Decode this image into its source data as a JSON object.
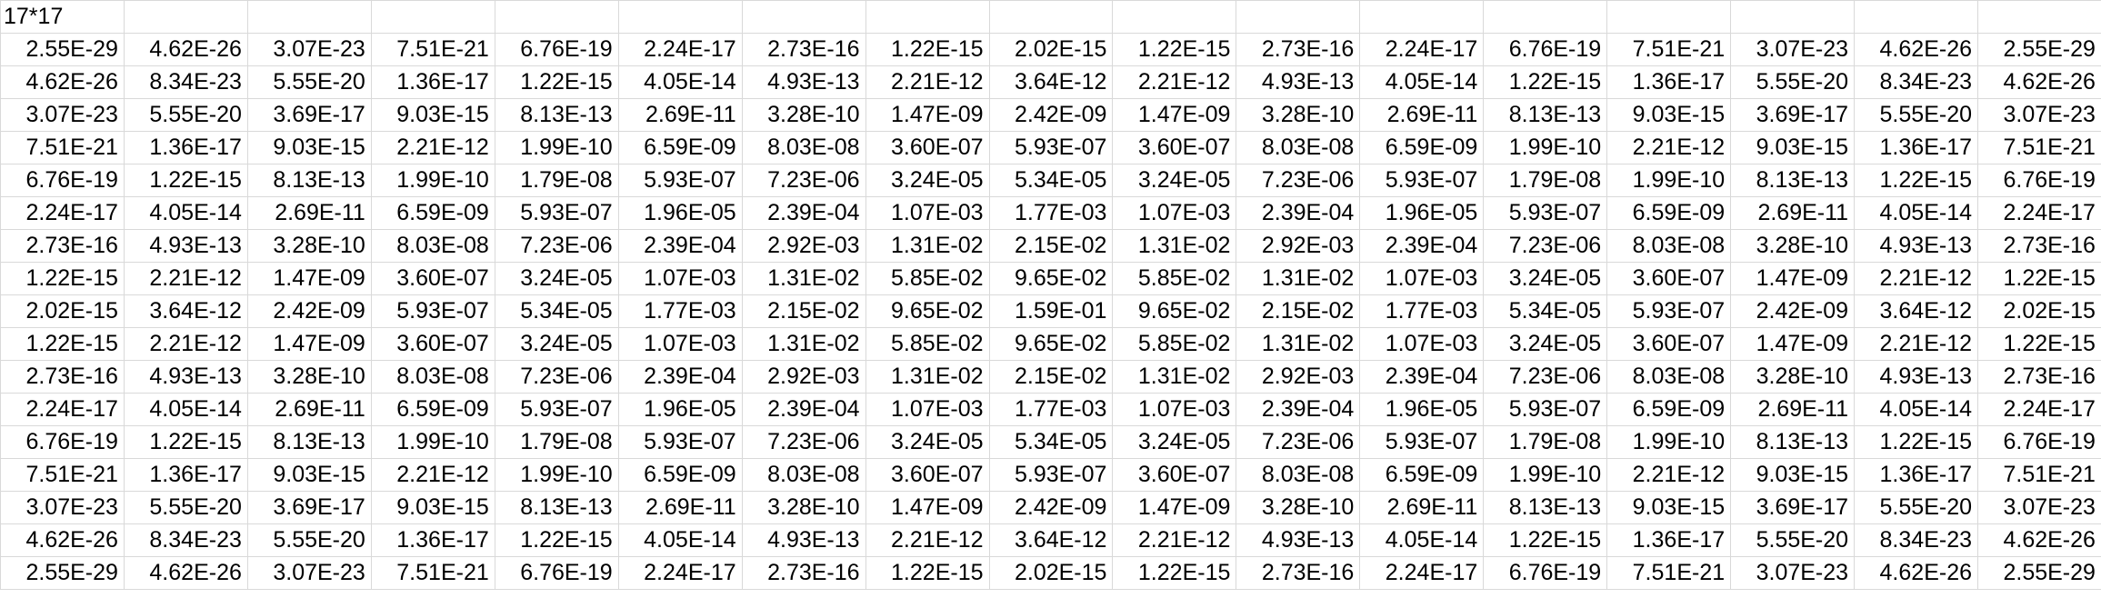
{
  "sheet": {
    "title_cell": "17*17",
    "rows": [
      [
        "2.55E-29",
        "4.62E-26",
        "3.07E-23",
        "7.51E-21",
        "6.76E-19",
        "2.24E-17",
        "2.73E-16",
        "1.22E-15",
        "2.02E-15",
        "1.22E-15",
        "2.73E-16",
        "2.24E-17",
        "6.76E-19",
        "7.51E-21",
        "3.07E-23",
        "4.62E-26",
        "2.55E-29"
      ],
      [
        "4.62E-26",
        "8.34E-23",
        "5.55E-20",
        "1.36E-17",
        "1.22E-15",
        "4.05E-14",
        "4.93E-13",
        "2.21E-12",
        "3.64E-12",
        "2.21E-12",
        "4.93E-13",
        "4.05E-14",
        "1.22E-15",
        "1.36E-17",
        "5.55E-20",
        "8.34E-23",
        "4.62E-26"
      ],
      [
        "3.07E-23",
        "5.55E-20",
        "3.69E-17",
        "9.03E-15",
        "8.13E-13",
        "2.69E-11",
        "3.28E-10",
        "1.47E-09",
        "2.42E-09",
        "1.47E-09",
        "3.28E-10",
        "2.69E-11",
        "8.13E-13",
        "9.03E-15",
        "3.69E-17",
        "5.55E-20",
        "3.07E-23"
      ],
      [
        "7.51E-21",
        "1.36E-17",
        "9.03E-15",
        "2.21E-12",
        "1.99E-10",
        "6.59E-09",
        "8.03E-08",
        "3.60E-07",
        "5.93E-07",
        "3.60E-07",
        "8.03E-08",
        "6.59E-09",
        "1.99E-10",
        "2.21E-12",
        "9.03E-15",
        "1.36E-17",
        "7.51E-21"
      ],
      [
        "6.76E-19",
        "1.22E-15",
        "8.13E-13",
        "1.99E-10",
        "1.79E-08",
        "5.93E-07",
        "7.23E-06",
        "3.24E-05",
        "5.34E-05",
        "3.24E-05",
        "7.23E-06",
        "5.93E-07",
        "1.79E-08",
        "1.99E-10",
        "8.13E-13",
        "1.22E-15",
        "6.76E-19"
      ],
      [
        "2.24E-17",
        "4.05E-14",
        "2.69E-11",
        "6.59E-09",
        "5.93E-07",
        "1.96E-05",
        "2.39E-04",
        "1.07E-03",
        "1.77E-03",
        "1.07E-03",
        "2.39E-04",
        "1.96E-05",
        "5.93E-07",
        "6.59E-09",
        "2.69E-11",
        "4.05E-14",
        "2.24E-17"
      ],
      [
        "2.73E-16",
        "4.93E-13",
        "3.28E-10",
        "8.03E-08",
        "7.23E-06",
        "2.39E-04",
        "2.92E-03",
        "1.31E-02",
        "2.15E-02",
        "1.31E-02",
        "2.92E-03",
        "2.39E-04",
        "7.23E-06",
        "8.03E-08",
        "3.28E-10",
        "4.93E-13",
        "2.73E-16"
      ],
      [
        "1.22E-15",
        "2.21E-12",
        "1.47E-09",
        "3.60E-07",
        "3.24E-05",
        "1.07E-03",
        "1.31E-02",
        "5.85E-02",
        "9.65E-02",
        "5.85E-02",
        "1.31E-02",
        "1.07E-03",
        "3.24E-05",
        "3.60E-07",
        "1.47E-09",
        "2.21E-12",
        "1.22E-15"
      ],
      [
        "2.02E-15",
        "3.64E-12",
        "2.42E-09",
        "5.93E-07",
        "5.34E-05",
        "1.77E-03",
        "2.15E-02",
        "9.65E-02",
        "1.59E-01",
        "9.65E-02",
        "2.15E-02",
        "1.77E-03",
        "5.34E-05",
        "5.93E-07",
        "2.42E-09",
        "3.64E-12",
        "2.02E-15"
      ],
      [
        "1.22E-15",
        "2.21E-12",
        "1.47E-09",
        "3.60E-07",
        "3.24E-05",
        "1.07E-03",
        "1.31E-02",
        "5.85E-02",
        "9.65E-02",
        "5.85E-02",
        "1.31E-02",
        "1.07E-03",
        "3.24E-05",
        "3.60E-07",
        "1.47E-09",
        "2.21E-12",
        "1.22E-15"
      ],
      [
        "2.73E-16",
        "4.93E-13",
        "3.28E-10",
        "8.03E-08",
        "7.23E-06",
        "2.39E-04",
        "2.92E-03",
        "1.31E-02",
        "2.15E-02",
        "1.31E-02",
        "2.92E-03",
        "2.39E-04",
        "7.23E-06",
        "8.03E-08",
        "3.28E-10",
        "4.93E-13",
        "2.73E-16"
      ],
      [
        "2.24E-17",
        "4.05E-14",
        "2.69E-11",
        "6.59E-09",
        "5.93E-07",
        "1.96E-05",
        "2.39E-04",
        "1.07E-03",
        "1.77E-03",
        "1.07E-03",
        "2.39E-04",
        "1.96E-05",
        "5.93E-07",
        "6.59E-09",
        "2.69E-11",
        "4.05E-14",
        "2.24E-17"
      ],
      [
        "6.76E-19",
        "1.22E-15",
        "8.13E-13",
        "1.99E-10",
        "1.79E-08",
        "5.93E-07",
        "7.23E-06",
        "3.24E-05",
        "5.34E-05",
        "3.24E-05",
        "7.23E-06",
        "5.93E-07",
        "1.79E-08",
        "1.99E-10",
        "8.13E-13",
        "1.22E-15",
        "6.76E-19"
      ],
      [
        "7.51E-21",
        "1.36E-17",
        "9.03E-15",
        "2.21E-12",
        "1.99E-10",
        "6.59E-09",
        "8.03E-08",
        "3.60E-07",
        "5.93E-07",
        "3.60E-07",
        "8.03E-08",
        "6.59E-09",
        "1.99E-10",
        "2.21E-12",
        "9.03E-15",
        "1.36E-17",
        "7.51E-21"
      ],
      [
        "3.07E-23",
        "5.55E-20",
        "3.69E-17",
        "9.03E-15",
        "8.13E-13",
        "2.69E-11",
        "3.28E-10",
        "1.47E-09",
        "2.42E-09",
        "1.47E-09",
        "3.28E-10",
        "2.69E-11",
        "8.13E-13",
        "9.03E-15",
        "3.69E-17",
        "5.55E-20",
        "3.07E-23"
      ],
      [
        "4.62E-26",
        "8.34E-23",
        "5.55E-20",
        "1.36E-17",
        "1.22E-15",
        "4.05E-14",
        "4.93E-13",
        "2.21E-12",
        "3.64E-12",
        "2.21E-12",
        "4.93E-13",
        "4.05E-14",
        "1.22E-15",
        "1.36E-17",
        "5.55E-20",
        "8.34E-23",
        "4.62E-26"
      ],
      [
        "2.55E-29",
        "4.62E-26",
        "3.07E-23",
        "7.51E-21",
        "6.76E-19",
        "2.24E-17",
        "2.73E-16",
        "1.22E-15",
        "2.02E-15",
        "1.22E-15",
        "2.73E-16",
        "2.24E-17",
        "6.76E-19",
        "7.51E-21",
        "3.07E-23",
        "4.62E-26",
        "2.55E-29"
      ]
    ]
  },
  "colors": {
    "gridline": "#d9d9d9",
    "text": "#000000",
    "background": "#ffffff"
  }
}
